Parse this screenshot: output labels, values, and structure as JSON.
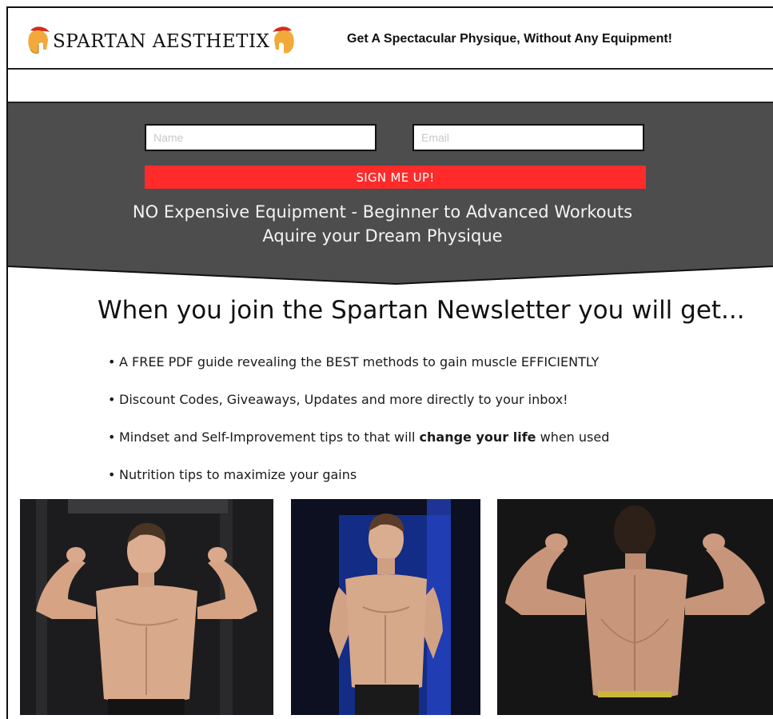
{
  "header": {
    "brand": "SPARTAN AESTHETIX",
    "brand_left": "SPARTAN A",
    "brand_mid": "Є",
    "brand_right": "STHЄTIX",
    "tagline": "Get A Spectacular Physique, Without Any Equipment!"
  },
  "signup": {
    "name_placeholder": "Name",
    "email_placeholder": "Email",
    "button_label": "SIGN ME UP!",
    "line1": "NO Expensive Equipment - Beginner to Advanced Workouts",
    "line2": "Aquire your Dream Physique"
  },
  "benefits": {
    "headline": "When you join the Spartan Newsletter you will get...",
    "items": [
      "A FREE PDF guide revealing the BEST methods to gain muscle EFFICIENTLY",
      "Discount Codes, Giveaways, Updates and more directly to your inbox!",
      "Mindset and Self-Improvement tips to that will",
      "Nutrition tips to maximize your gains"
    ],
    "item3_bold": "change your life",
    "item3_after": " when used"
  },
  "colors": {
    "accent": "#ff2b2b",
    "band": "#4d4d4d",
    "helmet": "#f2a93b"
  },
  "icons": {
    "helmet": "spartan-helmet-icon",
    "bullet": "bullet-dot"
  }
}
